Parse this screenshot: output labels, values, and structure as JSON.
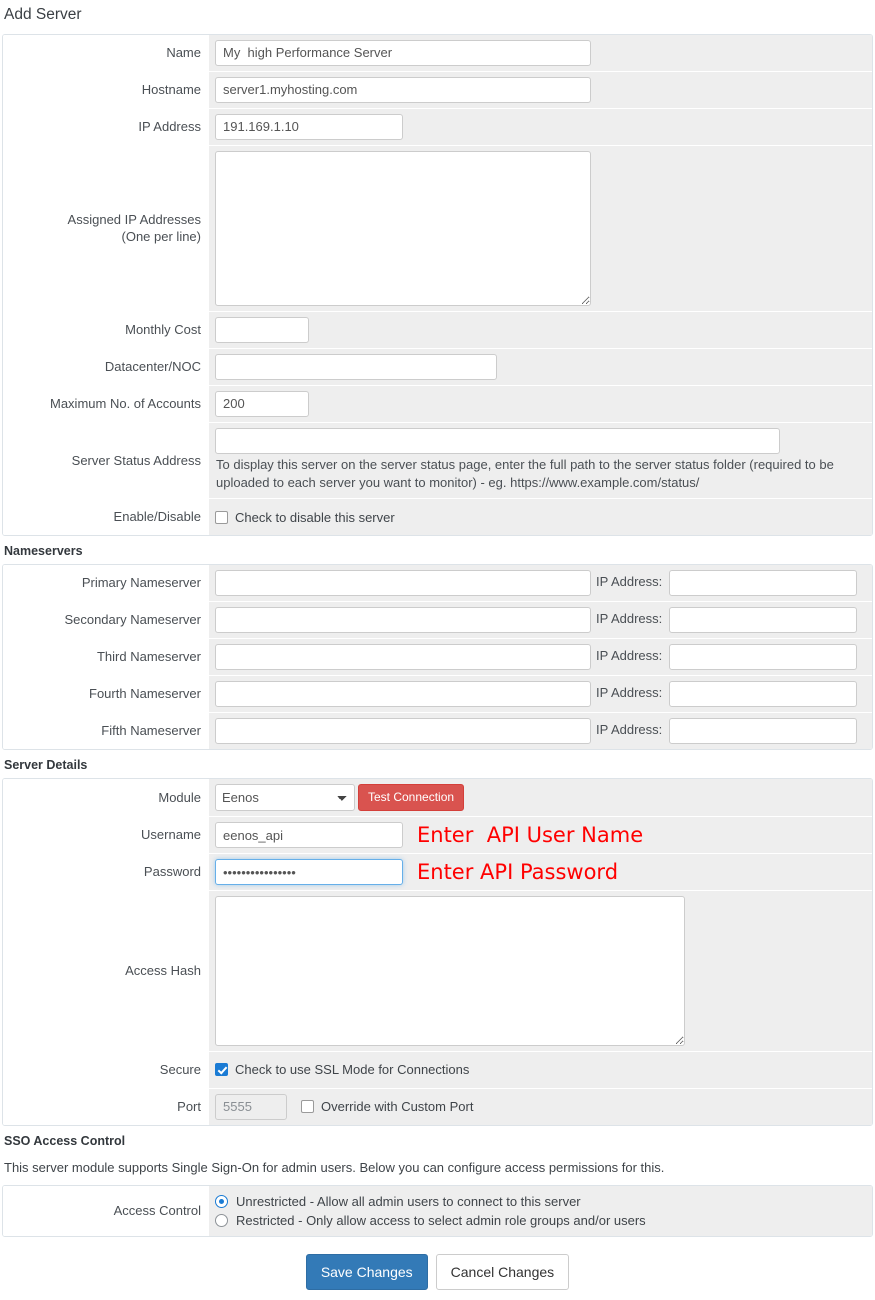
{
  "page": {
    "title": "Add Server"
  },
  "server": {
    "rows": {
      "name": {
        "label": "Name",
        "value": "My  high Performance Server"
      },
      "hostname": {
        "label": "Hostname",
        "value": "server1.myhosting.com"
      },
      "ip_address": {
        "label": "IP Address",
        "value": "191.169.1.10"
      },
      "assigned_ips": {
        "label_line1": "Assigned IP Addresses",
        "label_line2": "(One per line)",
        "value": ""
      },
      "monthly_cost": {
        "label": "Monthly Cost",
        "value": ""
      },
      "datacenter": {
        "label": "Datacenter/NOC",
        "value": ""
      },
      "max_accounts": {
        "label": "Maximum No. of Accounts",
        "value": "200"
      },
      "status_address": {
        "label": "Server Status Address",
        "value": "",
        "help": "To display this server on the server status page, enter the full path to the server status folder (required to be uploaded to each server you want to monitor) - eg. https://www.example.com/status/"
      },
      "enable_disable": {
        "label": "Enable/Disable",
        "checkbox_label": "Check to disable this server",
        "checked": false
      }
    }
  },
  "nameservers": {
    "heading": "Nameservers",
    "ip_label": "IP Address:",
    "items": [
      {
        "label": "Primary Nameserver",
        "value": "",
        "ip": ""
      },
      {
        "label": "Secondary Nameserver",
        "value": "",
        "ip": ""
      },
      {
        "label": "Third Nameserver",
        "value": "",
        "ip": ""
      },
      {
        "label": "Fourth Nameserver",
        "value": "",
        "ip": ""
      },
      {
        "label": "Fifth Nameserver",
        "value": "",
        "ip": ""
      }
    ]
  },
  "server_details": {
    "heading": "Server Details",
    "module": {
      "label": "Module",
      "selected": "Eenos",
      "test_button": "Test Connection"
    },
    "username": {
      "label": "Username",
      "value": "eenos_api",
      "annotation": "Enter  API User Name"
    },
    "password": {
      "label": "Password",
      "value": "••••••••••••••••",
      "annotation": "Enter API Password"
    },
    "access_hash": {
      "label": "Access Hash",
      "value": ""
    },
    "secure": {
      "label": "Secure",
      "checkbox_label": "Check to use SSL Mode for Connections",
      "checked": true
    },
    "port": {
      "label": "Port",
      "value": "5555",
      "checkbox_label": "Override with Custom Port",
      "checked": false
    }
  },
  "sso": {
    "heading": "SSO Access Control",
    "description": "This server module supports Single Sign-On for admin users. Below you can configure access permissions for this.",
    "access_control_label": "Access Control",
    "options": [
      {
        "label": "Unrestricted - Allow all admin users to connect to this server",
        "selected": true
      },
      {
        "label": "Restricted - Only allow access to select admin role groups and/or users",
        "selected": false
      }
    ]
  },
  "actions": {
    "save_label": "Save Changes",
    "cancel_label": "Cancel Changes"
  },
  "colors": {
    "primary": "#337ab7",
    "danger": "#d9534f",
    "annotation": "#ff0000",
    "row_bg": "#eeeeee"
  }
}
